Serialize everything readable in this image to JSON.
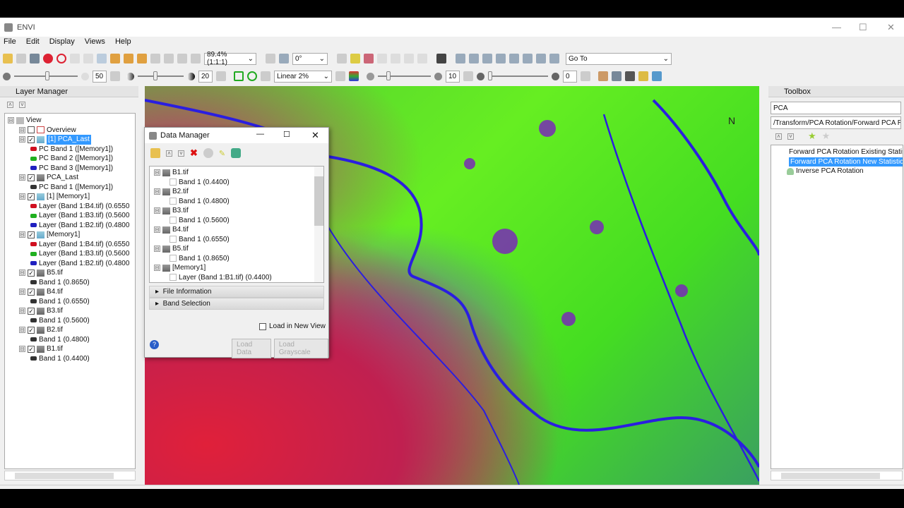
{
  "app": {
    "title": "ENVI",
    "menus": [
      "File",
      "Edit",
      "Display",
      "Views",
      "Help"
    ]
  },
  "toolbar": {
    "zoom": "89.4% (1:1:1)",
    "rotation": "0°",
    "goto": "Go To",
    "brightness": "50",
    "contrast": "20",
    "stretch": "Linear 2%",
    "sharpen": "10",
    "transparency": "0"
  },
  "layer_manager": {
    "title": "Layer Manager",
    "items": [
      {
        "level": 0,
        "label": "View",
        "type": "view"
      },
      {
        "level": 1,
        "label": "Overview",
        "type": "overview",
        "checked": false
      },
      {
        "level": 1,
        "label": "[1] PCA_Last",
        "type": "rgb",
        "checked": true,
        "selected": true
      },
      {
        "level": 2,
        "label": "PC Band 1 ([Memory1])",
        "color": "#d01020"
      },
      {
        "level": 2,
        "label": "PC Band 2 ([Memory1])",
        "color": "#20b020"
      },
      {
        "level": 2,
        "label": "PC Band 3 ([Memory1])",
        "color": "#2020c0"
      },
      {
        "level": 1,
        "label": "PCA_Last",
        "type": "gray",
        "checked": true
      },
      {
        "level": 2,
        "label": "PC Band 1 ([Memory1])",
        "color": "#333"
      },
      {
        "level": 1,
        "label": "[1] [Memory1]",
        "type": "rgb",
        "checked": true
      },
      {
        "level": 2,
        "label": "Layer (Band 1:B4.tif) (0.6550",
        "color": "#d01020"
      },
      {
        "level": 2,
        "label": "Layer (Band 1:B3.tif) (0.5600",
        "color": "#20b020"
      },
      {
        "level": 2,
        "label": "Layer (Band 1:B2.tif) (0.4800",
        "color": "#2020c0"
      },
      {
        "level": 1,
        "label": "[Memory1]",
        "type": "rgb",
        "checked": true
      },
      {
        "level": 2,
        "label": "Layer (Band 1:B4.tif) (0.6550",
        "color": "#d01020"
      },
      {
        "level": 2,
        "label": "Layer (Band 1:B3.tif) (0.5600",
        "color": "#20b020"
      },
      {
        "level": 2,
        "label": "Layer (Band 1:B2.tif) (0.4800",
        "color": "#2020c0"
      },
      {
        "level": 1,
        "label": "B5.tif",
        "type": "gray",
        "checked": true
      },
      {
        "level": 2,
        "label": "Band 1 (0.8650)",
        "color": "#333"
      },
      {
        "level": 1,
        "label": "B4.tif",
        "type": "gray",
        "checked": true
      },
      {
        "level": 2,
        "label": "Band 1 (0.6550)",
        "color": "#333"
      },
      {
        "level": 1,
        "label": "B3.tif",
        "type": "gray",
        "checked": true
      },
      {
        "level": 2,
        "label": "Band 1 (0.5600)",
        "color": "#333"
      },
      {
        "level": 1,
        "label": "B2.tif",
        "type": "gray",
        "checked": true
      },
      {
        "level": 2,
        "label": "Band 1 (0.4800)",
        "color": "#333"
      },
      {
        "level": 1,
        "label": "B1.tif",
        "type": "gray",
        "checked": true
      },
      {
        "level": 2,
        "label": "Band 1 (0.4400)",
        "color": "#333"
      }
    ]
  },
  "data_manager": {
    "title": "Data Manager",
    "items": [
      {
        "level": 0,
        "label": "B1.tif"
      },
      {
        "level": 1,
        "label": "Band 1 (0.4400)"
      },
      {
        "level": 0,
        "label": "B2.tif"
      },
      {
        "level": 1,
        "label": "Band 1 (0.4800)"
      },
      {
        "level": 0,
        "label": "B3.tif"
      },
      {
        "level": 1,
        "label": "Band 1 (0.5600)"
      },
      {
        "level": 0,
        "label": "B4.tif"
      },
      {
        "level": 1,
        "label": "Band 1 (0.6550)"
      },
      {
        "level": 0,
        "label": "B5.tif"
      },
      {
        "level": 1,
        "label": "Band 1 (0.8650)"
      },
      {
        "level": 0,
        "label": "[Memory1]"
      },
      {
        "level": 1,
        "label": "Layer (Band 1:B1.tif) (0.4400)"
      }
    ],
    "file_information": "File Information",
    "band_selection": "Band Selection",
    "load_new_view": "Load in New View",
    "load_data": "Load Data",
    "load_grayscale": "Load Grayscale"
  },
  "toolbox": {
    "title": "Toolbox",
    "search": "PCA",
    "path": "/Transform/PCA Rotation/Forward PCA Rotat",
    "items": [
      {
        "label": "Forward PCA Rotation Existing Statist",
        "selected": false
      },
      {
        "label": "Forward PCA Rotation New Statistics",
        "selected": true
      },
      {
        "label": "Inverse PCA Rotation",
        "selected": false
      }
    ]
  }
}
